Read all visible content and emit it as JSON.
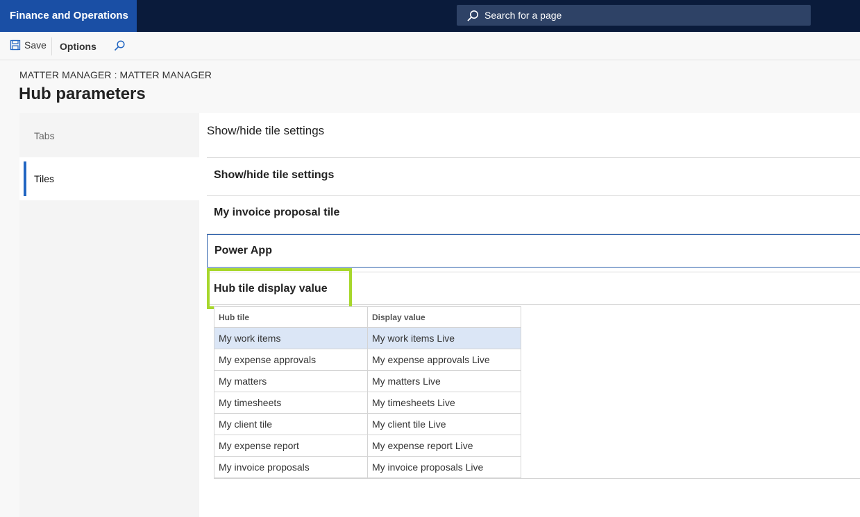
{
  "app": {
    "title": "Finance and Operations"
  },
  "search": {
    "placeholder": "Search for a page",
    "icon": "search-icon"
  },
  "toolbar": {
    "save_label": "Save",
    "options_label": "Options"
  },
  "breadcrumb": "MATTER MANAGER : MATTER MANAGER",
  "page_title": "Hub parameters",
  "nav": {
    "items": [
      {
        "label": "Tabs"
      },
      {
        "label": "Tiles",
        "selected": true
      }
    ]
  },
  "section": {
    "title": "Show/hide tile settings",
    "groups": [
      {
        "label": "Show/hide tile settings"
      },
      {
        "label": "My invoice proposal tile"
      },
      {
        "label": "Power App"
      },
      {
        "label": "Hub tile display value"
      }
    ]
  },
  "grid": {
    "columns": [
      "Hub tile",
      "Display value"
    ],
    "rows": [
      {
        "hub_tile": "My work items",
        "display_value": "My work items Live"
      },
      {
        "hub_tile": "My expense approvals",
        "display_value": "My expense approvals Live"
      },
      {
        "hub_tile": "My matters",
        "display_value": "My matters Live"
      },
      {
        "hub_tile": "My timesheets",
        "display_value": "My timesheets Live"
      },
      {
        "hub_tile": "My client tile",
        "display_value": "My client tile Live"
      },
      {
        "hub_tile": "My expense report",
        "display_value": "My expense report Live"
      },
      {
        "hub_tile": "My invoice proposals",
        "display_value": "My invoice proposals Live"
      }
    ]
  },
  "colors": {
    "topbar": "#0a1b3b",
    "brand": "#1a4fa5",
    "accent": "#2266c2",
    "highlight": "#a7d72c",
    "selected_row": "#dbe6f6"
  }
}
